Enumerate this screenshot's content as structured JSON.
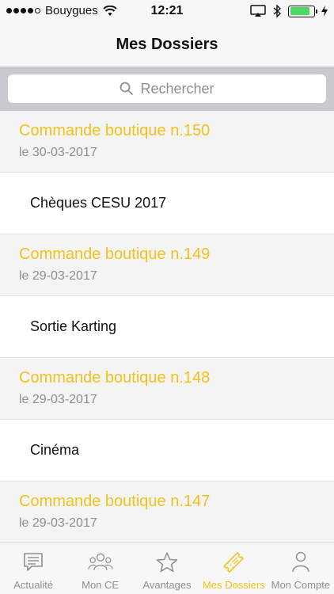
{
  "status_bar": {
    "carrier": "Bouygues",
    "time": "12:21",
    "battery_level": 0.85
  },
  "nav": {
    "title": "Mes Dossiers"
  },
  "search": {
    "placeholder": "Rechercher"
  },
  "list": [
    {
      "type": "order",
      "title": "Commande boutique n.150",
      "date": "le 30-03-2017"
    },
    {
      "type": "item",
      "label": "Chèques CESU 2017"
    },
    {
      "type": "order",
      "title": "Commande boutique n.149",
      "date": "le 29-03-2017"
    },
    {
      "type": "item",
      "label": "Sortie Karting"
    },
    {
      "type": "order",
      "title": "Commande boutique n.148",
      "date": "le 29-03-2017"
    },
    {
      "type": "item",
      "label": "Cinéma"
    },
    {
      "type": "order",
      "title": "Commande boutique n.147",
      "date": "le 29-03-2017"
    }
  ],
  "tabs": [
    {
      "label": "Actualité",
      "icon": "message-icon",
      "active": false
    },
    {
      "label": "Mon CE",
      "icon": "group-icon",
      "active": false
    },
    {
      "label": "Avantages",
      "icon": "star-icon",
      "active": false
    },
    {
      "label": "Mes Dossiers",
      "icon": "ticket-icon",
      "active": true
    },
    {
      "label": "Mon Compte",
      "icon": "person-icon",
      "active": false
    }
  ],
  "colors": {
    "accent": "#f2c11d",
    "muted": "#8e8e93",
    "battery": "#4cd964"
  }
}
